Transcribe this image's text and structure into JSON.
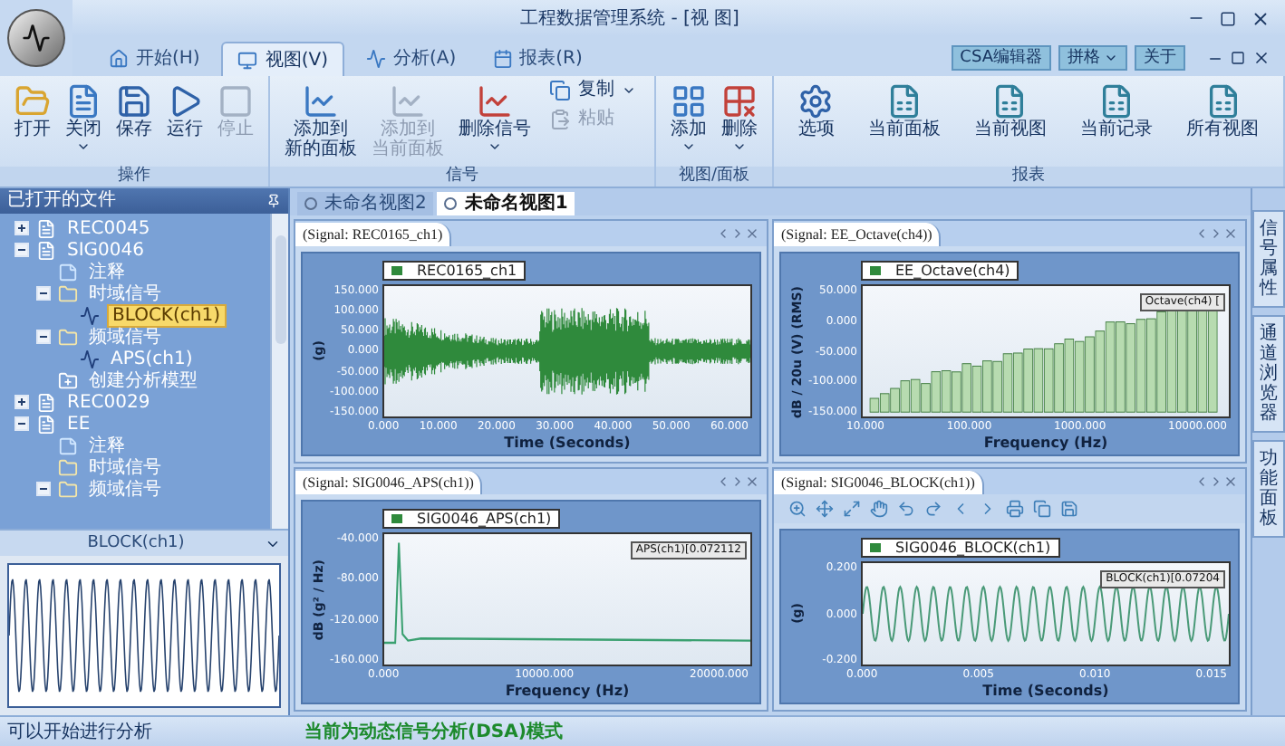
{
  "window": {
    "title": "工程数据管理系统 - [视 图]"
  },
  "tabs": [
    {
      "label": "开始(H)",
      "kind": "home",
      "selected": false
    },
    {
      "label": "视图(V)",
      "kind": "view",
      "selected": true
    },
    {
      "label": "分析(A)",
      "kind": "analysis",
      "selected": false
    },
    {
      "label": "报表(R)",
      "kind": "report",
      "selected": false
    }
  ],
  "quick_buttons": [
    {
      "label": "CSA编辑器",
      "dropdown": false
    },
    {
      "label": "拼格",
      "dropdown": true
    },
    {
      "label": "关于",
      "dropdown": false
    }
  ],
  "ribbon": [
    {
      "label": "操作",
      "buttons": [
        {
          "kind": "open",
          "lines": [
            "打开"
          ],
          "dropdown": false,
          "disabled": false
        },
        {
          "kind": "close",
          "lines": [
            "关闭"
          ],
          "dropdown": true,
          "disabled": false
        },
        {
          "kind": "save",
          "lines": [
            "保存"
          ],
          "dropdown": false,
          "disabled": false
        },
        {
          "kind": "run",
          "lines": [
            "运行"
          ],
          "dropdown": false,
          "disabled": false
        },
        {
          "kind": "stop",
          "lines": [
            "停止"
          ],
          "dropdown": false,
          "disabled": true
        }
      ]
    },
    {
      "label": "信号",
      "buttons": [
        {
          "kind": "chart_add",
          "lines": [
            "添加到",
            "新的面板"
          ],
          "dropdown": false,
          "disabled": false
        },
        {
          "kind": "chart_add",
          "lines": [
            "添加到",
            "当前面板"
          ],
          "dropdown": false,
          "disabled": true
        },
        {
          "kind": "chart_remove",
          "lines": [
            "删除信号"
          ],
          "dropdown": true,
          "disabled": false
        },
        {
          "kind": "small_stack",
          "items": [
            {
              "kind": "copy",
              "label": "复制",
              "dropdown": true,
              "disabled": false
            },
            {
              "kind": "paste",
              "label": "粘贴",
              "dropdown": false,
              "disabled": true
            }
          ]
        }
      ]
    },
    {
      "label": "视图/面板",
      "buttons": [
        {
          "kind": "grid_add",
          "lines": [
            "添加"
          ],
          "dropdown": true,
          "disabled": false
        },
        {
          "kind": "grid_remove",
          "lines": [
            "删除"
          ],
          "dropdown": true,
          "disabled": false
        }
      ]
    },
    {
      "label": "报表",
      "buttons": [
        {
          "kind": "options",
          "lines": [
            "选项"
          ],
          "dropdown": false,
          "disabled": false
        },
        {
          "kind": "report",
          "lines": [
            "当前面板"
          ],
          "dropdown": false,
          "disabled": false
        },
        {
          "kind": "report",
          "lines": [
            "当前视图"
          ],
          "dropdown": false,
          "disabled": false
        },
        {
          "kind": "report",
          "lines": [
            "当前记录"
          ],
          "dropdown": false,
          "disabled": false
        },
        {
          "kind": "report",
          "lines": [
            "所有视图"
          ],
          "dropdown": false,
          "disabled": false
        }
      ]
    }
  ],
  "files_panel": {
    "title": "已打开的文件",
    "tree": [
      {
        "label": "REC0045",
        "kind": "record",
        "expanded": false,
        "selected": false
      },
      {
        "label": "SIG0046",
        "kind": "record",
        "expanded": true,
        "selected": false,
        "children": [
          {
            "label": "注释",
            "kind": "note",
            "selected": false
          },
          {
            "label": "时域信号",
            "kind": "folder",
            "expanded": true,
            "selected": false,
            "children": [
              {
                "label": "BLOCK(ch1)",
                "kind": "signal",
                "selected": true
              }
            ]
          },
          {
            "label": "频域信号",
            "kind": "folder",
            "expanded": true,
            "selected": false,
            "children": [
              {
                "label": "APS(ch1)",
                "kind": "signal",
                "selected": false
              }
            ]
          },
          {
            "label": "创建分析模型",
            "kind": "model",
            "selected": false
          }
        ]
      },
      {
        "label": "REC0029",
        "kind": "record",
        "expanded": false,
        "selected": false
      },
      {
        "label": "EE",
        "kind": "record",
        "expanded": true,
        "selected": false,
        "children": [
          {
            "label": "注释",
            "kind": "note",
            "selected": false
          },
          {
            "label": "时域信号",
            "kind": "folder",
            "selected": false
          },
          {
            "label": "频域信号",
            "kind": "folder",
            "expanded": true,
            "selected": false
          }
        ]
      }
    ]
  },
  "preview": {
    "title": "BLOCK(ch1)"
  },
  "doc_tabs": [
    {
      "label": "未命名视图2",
      "selected": false
    },
    {
      "label": "未命名视图1",
      "selected": true
    }
  ],
  "panels": [
    {
      "title": "(Signal: REC0165_ch1)",
      "kind": "noise",
      "toolbar": false,
      "legend": "REC0165_ch1",
      "yticks": [
        "150.000",
        "100.000",
        "50.000",
        "0.000",
        "-50.000",
        "-100.000",
        "-150.000"
      ],
      "ylabel": "(g)",
      "xticks": [
        "0.000",
        "10.000",
        "20.000",
        "30.000",
        "40.000",
        "50.000",
        "60.000"
      ],
      "xlabel": "Time (Seconds)"
    },
    {
      "title": "(Signal: EE_Octave(ch4))",
      "kind": "octave",
      "toolbar": false,
      "legend": "EE_Octave(ch4)",
      "yticks": [
        "50.000",
        "0.000",
        "-50.000",
        "-100.000",
        "-150.000"
      ],
      "ylabel": "dB / 20u (V) (RMS)",
      "xticks": [
        "10.000",
        "100.000",
        "1000.000",
        "10000.000"
      ],
      "xlabel": "Frequency (Hz)",
      "cursor": "Octave(ch4) ["
    },
    {
      "title": "(Signal: SIG0046_APS(ch1))",
      "kind": "spectrum",
      "toolbar": false,
      "legend": "SIG0046_APS(ch1)",
      "yticks": [
        "-40.000",
        "-80.000",
        "-120.000",
        "-160.000"
      ],
      "ylabel": "dB (g² / Hz)",
      "xticks": [
        "0.000",
        "10000.000",
        "20000.000"
      ],
      "xlabel": "Frequency (Hz)",
      "cursor": "APS(ch1)[0.072112"
    },
    {
      "title": "(Signal: SIG0046_BLOCK(ch1))",
      "kind": "sine",
      "toolbar": true,
      "legend": "SIG0046_BLOCK(ch1)",
      "yticks": [
        "0.200",
        "0.000",
        "-0.200"
      ],
      "ylabel": "(g)",
      "xticks": [
        "0.000",
        "0.005",
        "0.010",
        "0.015"
      ],
      "xlabel": "Time (Seconds)",
      "cursor": "BLOCK(ch1)[0.07204"
    }
  ],
  "side_tabs": [
    {
      "label": "信号属性",
      "selected": false
    },
    {
      "label": "通道浏览器",
      "selected": false
    },
    {
      "label": "功能面板",
      "selected": false
    }
  ],
  "status_bar": {
    "left": "可以开始进行分析",
    "mode": "当前为动态信号分析(DSA)模式"
  }
}
